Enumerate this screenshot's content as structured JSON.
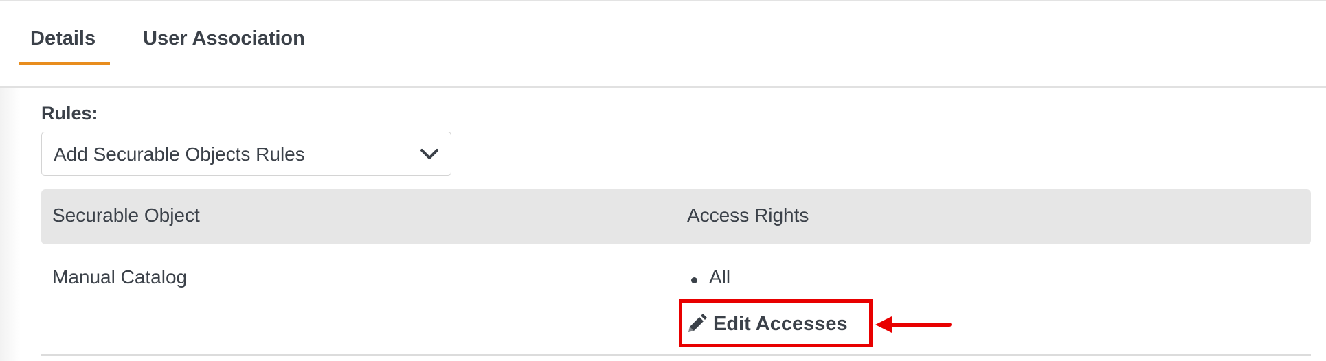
{
  "tabs": [
    {
      "label": "Details",
      "active": true
    },
    {
      "label": "User Association",
      "active": false
    }
  ],
  "accent_color": "#e88d1e",
  "highlight_color": "#e80000",
  "rules": {
    "label": "Rules:",
    "dropdown_value": "Add Securable Objects Rules"
  },
  "table": {
    "columns": [
      "Securable Object",
      "Access Rights"
    ],
    "rows": [
      {
        "securable_object": "Manual Catalog",
        "access_rights": [
          "All"
        ]
      }
    ]
  },
  "actions": {
    "edit_label": "Edit Accesses"
  },
  "icons": {
    "dropdown": "chevron-down-icon",
    "edit": "pencil-icon",
    "annotation": "arrow-left-icon"
  }
}
